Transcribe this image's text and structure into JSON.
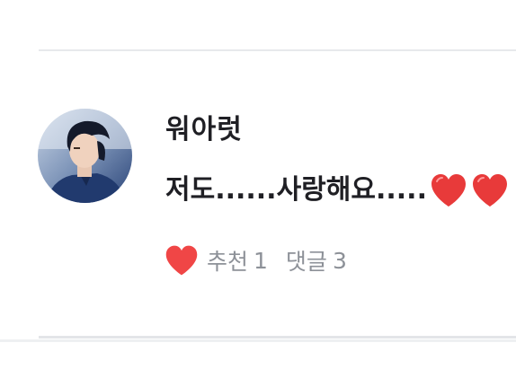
{
  "comment": {
    "author": "워아럿",
    "text": "저도......사랑해요.....",
    "text_icons": [
      "heart-icon",
      "heart-icon"
    ],
    "like_label": "추천",
    "like_count": "1",
    "reply_label": "댓글",
    "reply_count": "3"
  },
  "colors": {
    "heart": "#f04646",
    "meta_text": "#8d9198",
    "divider": "#e7e9ec",
    "text": "#1f1f24"
  }
}
